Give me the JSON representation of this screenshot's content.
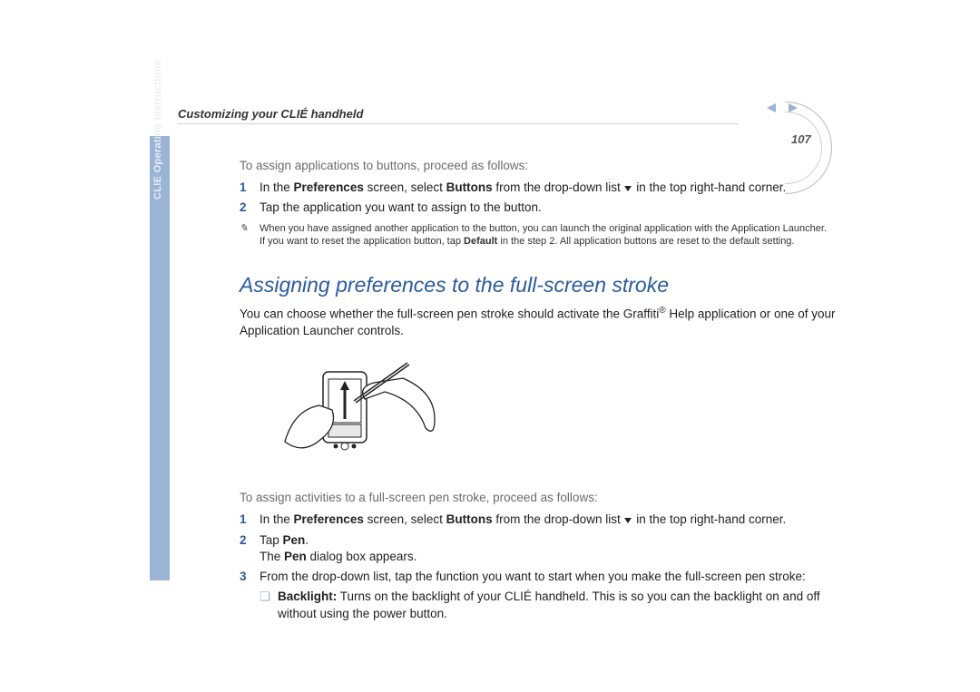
{
  "chapterTitle": "Customizing your CLIÉ handheld",
  "sidebarLabel": "CLIE Operating Instructions",
  "pageNumber": "107",
  "section1": {
    "intro": "To assign applications to buttons, proceed as follows:",
    "steps": [
      {
        "n": "1",
        "pre": "In the ",
        "b1": "Preferences",
        "mid1": " screen, select ",
        "b2": "Buttons",
        "mid2": " from the drop-down list ",
        "post": " in the top right-hand corner."
      },
      {
        "n": "2",
        "text": "Tap the application you want to assign to the button."
      }
    ],
    "note": {
      "line1": "When you have assigned another application to the button, you can launch the original application with the Application Launcher.",
      "line2a": "If you want to reset the application button, tap ",
      "line2b": "Default",
      "line2c": " in the step 2. All application buttons are reset to the default setting."
    }
  },
  "heading": "Assigning preferences to the full-screen stroke",
  "para1a": "You can choose whether the full-screen pen stroke should activate the Graffiti",
  "para1b": " Help application or one of your Application Launcher controls.",
  "section2": {
    "intro": "To assign activities to a full-screen pen stroke, proceed as follows:",
    "steps": {
      "s1": {
        "n": "1",
        "pre": "In the ",
        "b1": "Preferences",
        "mid1": " screen, select ",
        "b2": "Buttons",
        "mid2": " from the drop-down list ",
        "post": " in the top right-hand corner."
      },
      "s2": {
        "n": "2",
        "pre": "Tap ",
        "b": "Pen",
        "post": ".",
        "l2a": "The ",
        "l2b": "Pen",
        "l2c": " dialog box appears."
      },
      "s3": {
        "n": "3",
        "text": "From the drop-down list, tap the function you want to start when you make the full-screen pen stroke:"
      }
    },
    "bullet": {
      "b": "Backlight:",
      "t": " Turns on the backlight of your CLIÉ handheld. This is so you can the backlight on and off without using the power button."
    }
  }
}
